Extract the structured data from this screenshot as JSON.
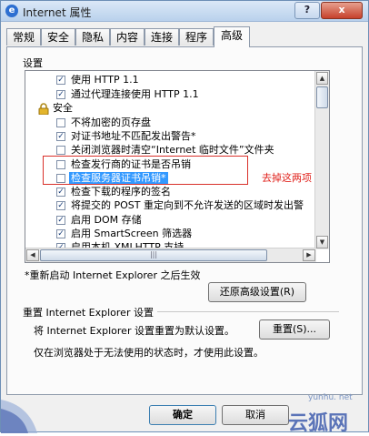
{
  "window": {
    "title": "Internet 属性",
    "help_glyph": "?",
    "close_glyph": "x",
    "title_icon_glyph": "e"
  },
  "tabs": [
    {
      "label": "常规"
    },
    {
      "label": "安全"
    },
    {
      "label": "隐私"
    },
    {
      "label": "内容"
    },
    {
      "label": "连接"
    },
    {
      "label": "程序"
    },
    {
      "label": "高级"
    }
  ],
  "settings_label": "设置",
  "settings_list": [
    {
      "type": "checkbox",
      "checked": true,
      "label": "使用 HTTP 1.1"
    },
    {
      "type": "checkbox",
      "checked": true,
      "label": "通过代理连接使用 HTTP 1.1"
    },
    {
      "type": "category",
      "label": "安全",
      "icon": "lock-icon"
    },
    {
      "type": "checkbox",
      "checked": false,
      "label": "不将加密的页存盘"
    },
    {
      "type": "checkbox",
      "checked": true,
      "label": "对证书地址不匹配发出警告*"
    },
    {
      "type": "checkbox",
      "checked": false,
      "label": "关闭浏览器时清空“Internet 临时文件”文件夹"
    },
    {
      "type": "checkbox",
      "checked": false,
      "label": "检查发行商的证书是否吊销"
    },
    {
      "type": "checkbox",
      "checked": false,
      "label": "检查服务器证书吊销*",
      "selected": true
    },
    {
      "type": "checkbox",
      "checked": true,
      "label": "检查下载的程序的签名"
    },
    {
      "type": "checkbox",
      "checked": true,
      "label": "将提交的 POST 重定向到不允许发送的区域时发出警"
    },
    {
      "type": "checkbox",
      "checked": true,
      "label": "启用 DOM 存储"
    },
    {
      "type": "checkbox",
      "checked": true,
      "label": "启用 SmartScreen 筛选器"
    },
    {
      "type": "checkbox",
      "checked": true,
      "label": "启用本机 XMLHTTP 支持"
    }
  ],
  "annotation": {
    "text": "去掉这两项"
  },
  "restart_note": "*重新启动 Internet Explorer 之后生效",
  "restore_button": "还原高级设置(R)",
  "reset_section": {
    "title": "重置 Internet Explorer 设置",
    "description": "将 Internet Explorer 设置重置为默认设置。",
    "button": "重置(S)...",
    "note": "仅在浏览器处于无法使用的状态时，才使用此设置。"
  },
  "footer": {
    "ok_button": "确定",
    "cancel_button": "取消"
  },
  "watermark": {
    "url": "yunhu. net",
    "brand": "云狐网"
  },
  "colors": {
    "annotation_red": "#e0211b",
    "selection_blue": "#3399ff"
  }
}
